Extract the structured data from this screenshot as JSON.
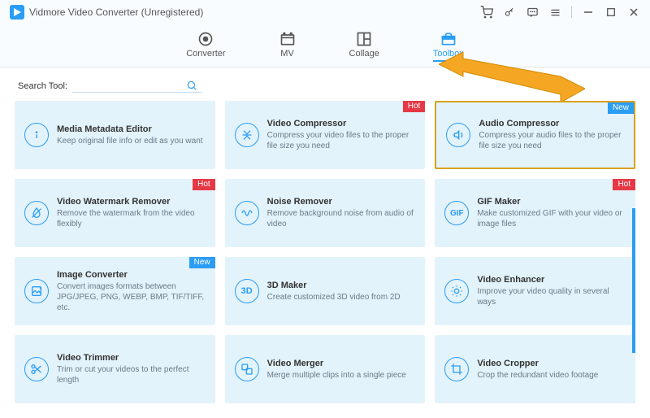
{
  "app": {
    "title": "Vidmore Video Converter (Unregistered)"
  },
  "tabs": [
    {
      "label": "Converter"
    },
    {
      "label": "MV"
    },
    {
      "label": "Collage"
    },
    {
      "label": "Toolbox"
    }
  ],
  "search": {
    "label": "Search Tool:",
    "placeholder": ""
  },
  "tools": [
    {
      "title": "Media Metadata Editor",
      "desc": "Keep original file info or edit as you want",
      "badge": null
    },
    {
      "title": "Video Compressor",
      "desc": "Compress your video files to the proper file size you need",
      "badge": "Hot"
    },
    {
      "title": "Audio Compressor",
      "desc": "Compress your audio files to the proper file size you need",
      "badge": "New"
    },
    {
      "title": "Video Watermark Remover",
      "desc": "Remove the watermark from the video flexibly",
      "badge": "Hot"
    },
    {
      "title": "Noise Remover",
      "desc": "Remove background noise from audio of video",
      "badge": null
    },
    {
      "title": "GIF Maker",
      "desc": "Make customized GIF with your video or image files",
      "badge": "Hot"
    },
    {
      "title": "Image Converter",
      "desc": "Convert images formats between JPG/JPEG, PNG, WEBP, BMP, TIF/TIFF, etc.",
      "badge": "New"
    },
    {
      "title": "3D Maker",
      "desc": "Create customized 3D video from 2D",
      "badge": null
    },
    {
      "title": "Video Enhancer",
      "desc": "Improve your video quality in several ways",
      "badge": null
    },
    {
      "title": "Video Trimmer",
      "desc": "Trim or cut your videos to the perfect length",
      "badge": null
    },
    {
      "title": "Video Merger",
      "desc": "Merge multiple clips into a single piece",
      "badge": null
    },
    {
      "title": "Video Cropper",
      "desc": "Crop the redundant video footage",
      "badge": null
    }
  ]
}
